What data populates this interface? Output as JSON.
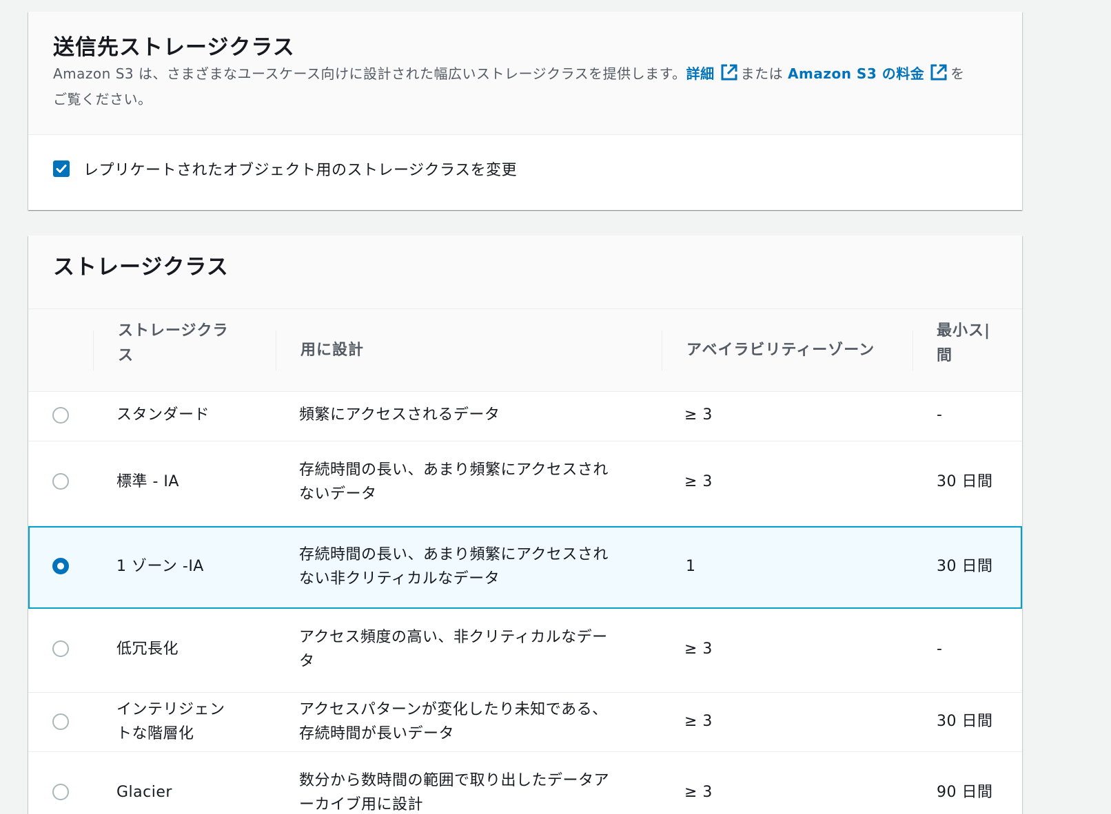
{
  "destination": {
    "title": "送信先ストレージクラス",
    "desc_part1": "Amazon S3 は、さまざまなユースケース向けに設計された幅広いストレージクラスを提供します。",
    "details_link": "詳細",
    "or_text": "または",
    "pricing_link": "Amazon S3 の料金",
    "desc_end": "を",
    "desc_line2": "ご覧ください。",
    "checkbox_label": "レプリケートされたオブジェクト用のストレージクラスを変更",
    "checkbox_checked": true
  },
  "storage": {
    "title": "ストレージクラス",
    "columns": {
      "class_line1": "ストレージクラ",
      "class_line2": "ス",
      "designed": "用に設計",
      "az": "アベイラビリティーゾーン",
      "min_line1": "最小ス|",
      "min_line2": "間"
    },
    "rows": [
      {
        "name": "スタンダード",
        "designed": [
          "頻繁にアクセスされるデータ"
        ],
        "az": "≥ 3",
        "min": "-",
        "selected": false
      },
      {
        "name": "標準 - IA",
        "designed": [
          "存続時間の長い、あまり頻繁にアクセスされ",
          "ないデータ"
        ],
        "az": "≥ 3",
        "min": "30 日間",
        "selected": false
      },
      {
        "name": "1 ゾーン -IA",
        "designed": [
          "存続時間の長い、あまり頻繁にアクセスされ",
          "ない非クリティカルなデータ"
        ],
        "az": "1",
        "min": "30 日間",
        "selected": true
      },
      {
        "name": "低冗長化",
        "designed": [
          "アクセス頻度の高い、非クリティカルなデー",
          "タ"
        ],
        "az": "≥ 3",
        "min": "-",
        "selected": false
      },
      {
        "name_lines": [
          "インテリジェン",
          "トな階層化"
        ],
        "designed": [
          "アクセスパターンが変化したり未知である、",
          "存続時間が長いデータ"
        ],
        "az": "≥ 3",
        "min": "30 日間",
        "selected": false
      },
      {
        "name": "Glacier",
        "designed": [
          "数分から数時間の範囲で取り出したデータア",
          "ーカイブ用に設計"
        ],
        "az": "≥ 3",
        "min": "90 日間",
        "selected": false
      }
    ]
  }
}
